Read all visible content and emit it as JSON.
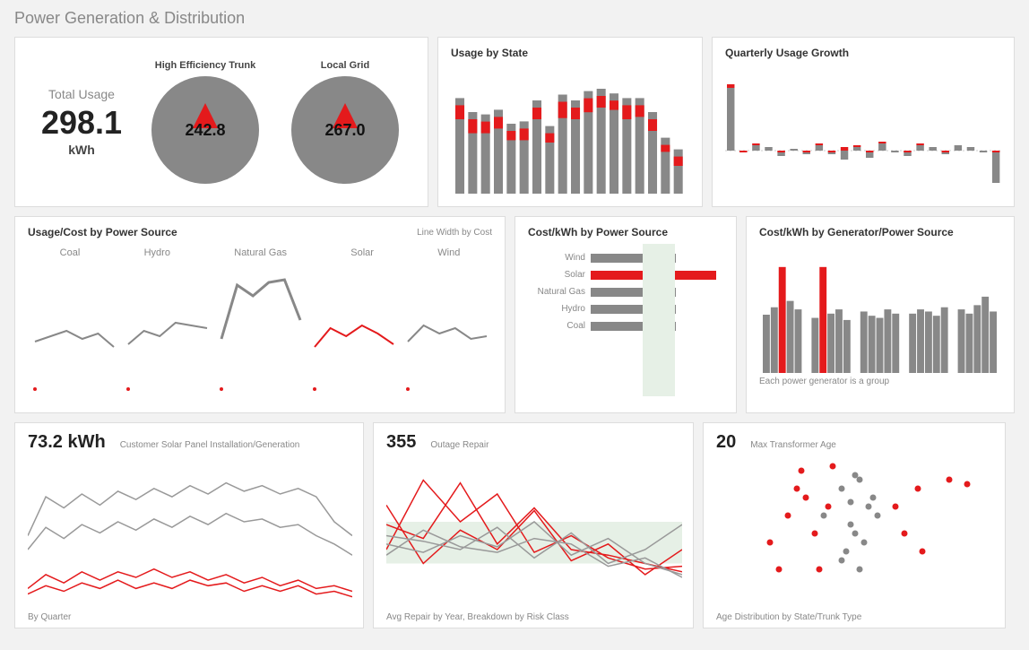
{
  "page_title": "Power Generation & Distribution",
  "total_usage": {
    "label": "Total Usage",
    "value": "298.1",
    "unit": "kWh"
  },
  "gauges": [
    {
      "title": "High Efficiency Trunk",
      "value": "242.8"
    },
    {
      "title": "Local Grid",
      "value": "267.0"
    }
  ],
  "usage_by_state_title": "Usage by State",
  "quarterly_growth_title": "Quarterly Usage Growth",
  "usage_cost_title": "Usage/Cost by Power Source",
  "usage_cost_note": "Line Width by Cost",
  "power_sources": [
    "Coal",
    "Hydro",
    "Natural Gas",
    "Solar",
    "Wind"
  ],
  "cost_kwh_title": "Cost/kWh by Power Source",
  "cost_kwh_gen_title": "Cost/kWh by Generator/Power Source",
  "cost_kwh_gen_note": "Each power generator is a group",
  "solar_panel": {
    "value": "73.2 kWh",
    "label": "Customer Solar Panel Installation/Generation",
    "footnote": "By Quarter"
  },
  "outage": {
    "value": "355",
    "label": "Outage Repair",
    "footnote": "Avg Repair by Year, Breakdown by Risk Class"
  },
  "transformer": {
    "value": "20",
    "label": "Max Transformer Age",
    "footnote": "Age Distribution by State/Trunk Type"
  },
  "chart_data": {
    "usage_by_state": {
      "type": "bar",
      "series": [
        {
          "name": "base",
          "values": [
            82,
            70,
            68,
            72,
            60,
            62,
            80,
            58,
            85,
            80,
            88,
            90,
            86,
            82,
            82,
            70,
            48,
            38
          ]
        },
        {
          "name": "highlight",
          "values": [
            12,
            12,
            10,
            10,
            8,
            10,
            10,
            8,
            14,
            10,
            12,
            10,
            8,
            12,
            10,
            10,
            6,
            8
          ]
        }
      ],
      "ylim": [
        0,
        100
      ]
    },
    "quarterly_growth": {
      "type": "bar",
      "series": [
        {
          "name": "gray",
          "values": [
            70,
            -2,
            6,
            4,
            -6,
            2,
            -4,
            6,
            -4,
            -10,
            4,
            -8,
            8,
            -2,
            -6,
            6,
            4,
            -4,
            6,
            4,
            -2,
            -36
          ]
        },
        {
          "name": "red",
          "values": [
            4,
            -2,
            2,
            0,
            -2,
            0,
            -2,
            2,
            -2,
            4,
            2,
            -2,
            2,
            0,
            -2,
            2,
            0,
            -2,
            0,
            0,
            0,
            -2
          ]
        }
      ],
      "ylim": [
        -40,
        80
      ]
    },
    "usage_cost_by_source": {
      "type": "line",
      "facets": {
        "Coal": {
          "color": "gray",
          "y": [
            38,
            42,
            46,
            40,
            44,
            34
          ],
          "width": 2
        },
        "Hydro": {
          "color": "gray",
          "y": [
            36,
            46,
            42,
            52,
            50,
            48
          ],
          "width": 2
        },
        "Natural Gas": {
          "color": "gray",
          "y": [
            40,
            80,
            72,
            82,
            84,
            54
          ],
          "width": 3
        },
        "Solar": {
          "color": "red",
          "y": [
            34,
            48,
            42,
            50,
            44,
            36
          ],
          "width": 2
        },
        "Wind": {
          "color": "gray",
          "y": [
            38,
            50,
            44,
            48,
            40,
            42
          ],
          "width": 2
        }
      },
      "ylim": [
        0,
        100
      ]
    },
    "cost_kwh_by_source": {
      "type": "bar-h",
      "categories": [
        "Wind",
        "Solar",
        "Natural Gas",
        "Hydro",
        "Coal"
      ],
      "values": [
        95,
        140,
        95,
        95,
        95
      ],
      "highlight": "Solar"
    },
    "cost_kwh_by_generator": {
      "type": "bar",
      "groups": [
        {
          "values": [
            55,
            62,
            100,
            68,
            60
          ],
          "red_index": 2
        },
        {
          "values": [
            52,
            100,
            56,
            60,
            50
          ],
          "red_index": 1
        },
        {
          "values": [
            58,
            54,
            52,
            60,
            56
          ],
          "red_index": null
        },
        {
          "values": [
            56,
            60,
            58,
            54,
            62
          ],
          "red_index": null
        },
        {
          "values": [
            60,
            56,
            64,
            72,
            58
          ],
          "red_index": null
        }
      ],
      "ylim": [
        0,
        110
      ]
    },
    "solar_panel_lines": {
      "type": "line",
      "series": [
        {
          "name": "s1",
          "color": "gray",
          "y": [
            50,
            78,
            70,
            80,
            72,
            82,
            76,
            84,
            78,
            86,
            80,
            88,
            82,
            86,
            80,
            84,
            78,
            60,
            50
          ]
        },
        {
          "name": "s2",
          "color": "gray",
          "y": [
            40,
            56,
            48,
            58,
            52,
            60,
            54,
            62,
            56,
            64,
            58,
            66,
            60,
            62,
            56,
            58,
            50,
            44,
            36
          ]
        },
        {
          "name": "s3",
          "color": "red",
          "y": [
            12,
            22,
            16,
            24,
            18,
            24,
            20,
            26,
            20,
            24,
            18,
            22,
            16,
            20,
            14,
            18,
            12,
            14,
            10
          ]
        },
        {
          "name": "s4",
          "color": "red",
          "y": [
            8,
            14,
            10,
            16,
            12,
            18,
            12,
            16,
            12,
            18,
            14,
            16,
            10,
            14,
            10,
            14,
            8,
            10,
            6
          ]
        }
      ],
      "ylim": [
        0,
        100
      ]
    },
    "outage_repair": {
      "type": "line",
      "band": [
        30,
        60
      ],
      "series": [
        {
          "color": "red",
          "y": [
            58,
            48,
            88,
            44,
            70,
            40,
            36,
            30,
            24
          ]
        },
        {
          "color": "red",
          "y": [
            40,
            90,
            60,
            80,
            38,
            50,
            34,
            26,
            28
          ]
        },
        {
          "color": "red",
          "y": [
            72,
            30,
            54,
            40,
            68,
            32,
            44,
            22,
            40
          ]
        },
        {
          "color": "gray",
          "y": [
            44,
            38,
            50,
            42,
            60,
            36,
            48,
            30,
            22
          ]
        },
        {
          "color": "gray",
          "y": [
            50,
            46,
            40,
            56,
            34,
            52,
            30,
            40,
            58
          ]
        },
        {
          "color": "gray",
          "y": [
            36,
            54,
            42,
            38,
            48,
            44,
            28,
            34,
            20
          ]
        }
      ],
      "ylim": [
        0,
        100
      ]
    },
    "transformer_scatter": {
      "type": "scatter",
      "series": [
        {
          "color": "gray",
          "points": [
            [
              120,
              70
            ],
            [
              140,
              40
            ],
            [
              150,
              55
            ],
            [
              160,
              30
            ],
            [
              155,
              90
            ],
            [
              170,
              60
            ],
            [
              145,
              110
            ],
            [
              160,
              130
            ],
            [
              175,
              50
            ],
            [
              150,
              80
            ],
            [
              165,
              100
            ],
            [
              155,
              25
            ],
            [
              180,
              70
            ],
            [
              140,
              120
            ]
          ]
        },
        {
          "color": "red",
          "points": [
            [
              60,
              100
            ],
            [
              80,
              70
            ],
            [
              100,
              50
            ],
            [
              115,
              130
            ],
            [
              95,
              20
            ],
            [
              210,
              90
            ],
            [
              225,
              40
            ],
            [
              260,
              30
            ],
            [
              280,
              35
            ],
            [
              130,
              15
            ],
            [
              70,
              130
            ],
            [
              110,
              90
            ],
            [
              200,
              60
            ],
            [
              230,
              110
            ],
            [
              90,
              40
            ],
            [
              125,
              60
            ]
          ]
        }
      ],
      "xlim": [
        0,
        300
      ],
      "ylim": [
        0,
        150
      ]
    }
  }
}
